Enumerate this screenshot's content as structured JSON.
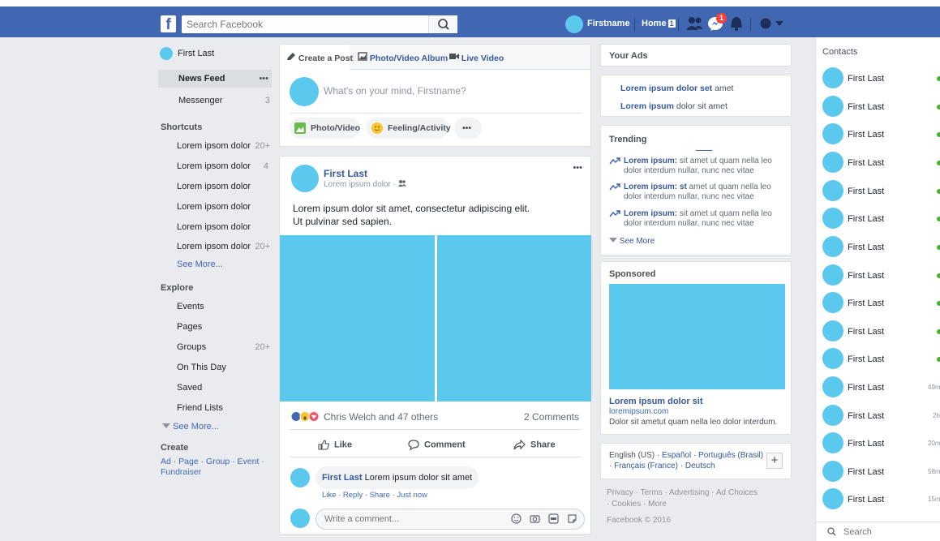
{
  "topbar": {
    "logo": "f",
    "search_placeholder": "Search Facebook",
    "user_name": "Firstname",
    "home_label": "Home",
    "home_count": "1",
    "notif_count": "1"
  },
  "left_nav": {
    "user": "First Last",
    "news_feed": "News Feed",
    "news_feed_more": "•••",
    "messenger": "Messenger",
    "messenger_count": "3",
    "shortcuts_head": "Shortcuts",
    "shortcuts": [
      {
        "label": "Lorem ipsom dolor",
        "count": "20+"
      },
      {
        "label": "Lorem ipsom dolor",
        "count": "4"
      },
      {
        "label": "Lorem ipsom dolor",
        "count": ""
      },
      {
        "label": "Lorem ipsom dolor",
        "count": ""
      },
      {
        "label": "Lorem ipsom dolor",
        "count": ""
      },
      {
        "label": "Lorem ipsom dolor",
        "count": "20+"
      }
    ],
    "shortcuts_see_more": "See More...",
    "explore_head": "Explore",
    "explore": [
      {
        "label": "Events",
        "count": ""
      },
      {
        "label": "Pages",
        "count": ""
      },
      {
        "label": "Groups",
        "count": "20+"
      },
      {
        "label": "On This Day",
        "count": ""
      },
      {
        "label": "Saved",
        "count": ""
      },
      {
        "label": "Friend Lists",
        "count": ""
      }
    ],
    "explore_see_more": "See More...",
    "create_head": "Create",
    "create_links_1": "Ad · Page · Group · Event ·",
    "create_links_2": "Fundraiser"
  },
  "composer": {
    "tab_create": "Create a Post",
    "tab_album": "Photo/Video Album",
    "tab_live": "Live Video",
    "placeholder": "What's on your mind, Firstname?",
    "btn_photo": "Photo/Video",
    "btn_feeling": "Feeling/Activity",
    "btn_more": "•••"
  },
  "post": {
    "author": "First Last",
    "sub": "Lorem ipsum dolor ·",
    "more": "•••",
    "text_line1": "Lorem ipsum dolor sit amet, consectetur adipiscing elit.",
    "text_line2": "Ut pulvinar sed sapien.",
    "reactions_text": "Chris Welch and 47 others",
    "comments_count": "2 Comments",
    "action_like": "Like",
    "action_comment": "Comment",
    "action_share": "Share",
    "comment_author": "First Last",
    "comment_text": "Lorem ipsum dolor sit amet",
    "comment_meta": "Like · Reply · Share · Just now",
    "comment_placeholder": "Write a comment..."
  },
  "right_col": {
    "ads_title": "Your Ads",
    "ad1_bold": "Lorem ipsum dolor set",
    "ad1_rest": "amet",
    "ad2_bold": "Lorem ipsum",
    "ad2_rest": "dolor sit amet",
    "trending_title": "Trending",
    "trends": [
      {
        "bold": "Lorem ipsum:",
        "rest": "sit amet ut quam nella leo dolor interdum nullar, nunc nec vitae"
      },
      {
        "bold": "Lorem ipsum: st",
        "rest": "amet ut quam nella leo dolor interdum nullar, nunc nec vitae"
      },
      {
        "bold": "Lorem ipsum:",
        "rest": "sit amet ut quam nella leo dolor interdum nullar, nunc nec vitae"
      }
    ],
    "trending_see_more": "See More",
    "sponsored_title": "Sponsored",
    "sponsored_headline": "Lorem ipsum dolor sit",
    "sponsored_url": "loremipsum.com",
    "sponsored_desc": "Dolor sit ametut quam nella leo dolor interdum.",
    "lang_current": "English (US) ·",
    "lang_links_1": "Español · Português (Brasil)",
    "lang_links_2": "· Français (France) · Deutsch",
    "lang_add": "+",
    "footer_1": "Privacy · Terms · Advertising · Ad Choices",
    "footer_2": "· Cookies · More",
    "footer_3": "Facebook © 2016"
  },
  "contacts": {
    "title": "Contacts",
    "search_placeholder": "Search",
    "list": [
      {
        "name": "First Last",
        "status": ""
      },
      {
        "name": "First Last",
        "status": ""
      },
      {
        "name": "First Last",
        "status": ""
      },
      {
        "name": "First Last",
        "status": ""
      },
      {
        "name": "First Last",
        "status": ""
      },
      {
        "name": "First Last",
        "status": ""
      },
      {
        "name": "First Last",
        "status": ""
      },
      {
        "name": "First Last",
        "status": ""
      },
      {
        "name": "First Last",
        "status": ""
      },
      {
        "name": "First Last",
        "status": ""
      },
      {
        "name": "First Last",
        "status": ""
      },
      {
        "name": "First Last",
        "status": "49m"
      },
      {
        "name": "First Last",
        "status": "2h"
      },
      {
        "name": "First Last",
        "status": "20m"
      },
      {
        "name": "First Last",
        "status": "58m"
      },
      {
        "name": "First Last",
        "status": "15m"
      }
    ]
  },
  "colors": {
    "brand_blue": "#4267b2",
    "avatar_blue": "#5bc8ed",
    "online_green": "#42b72a",
    "link_blue": "#365899"
  },
  "icons": [
    "facebook-logo-icon",
    "search-icon",
    "friends-icon",
    "messenger-icon",
    "notifications-icon",
    "help-icon",
    "chevron-down-icon",
    "pencil-icon",
    "photo-album-icon",
    "live-video-icon",
    "photo-video-icon",
    "feeling-icon",
    "more-icon",
    "friends-audience-icon",
    "like-reaction-icon",
    "wow-reaction-icon",
    "love-reaction-icon",
    "thumbs-up-icon",
    "comment-icon",
    "share-icon",
    "emoji-icon",
    "camera-icon",
    "gif-icon",
    "sticker-icon",
    "trending-arrow-icon",
    "plus-icon"
  ]
}
